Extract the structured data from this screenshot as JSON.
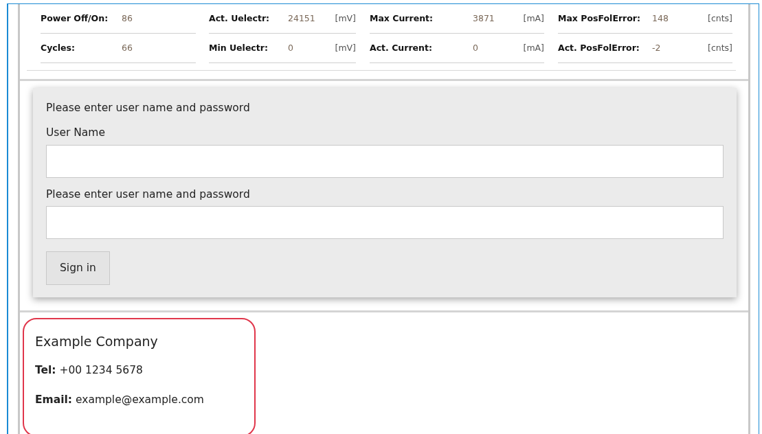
{
  "stats": {
    "columns": [
      {
        "rows": [
          {
            "label": "Power Off/On:",
            "value": "86"
          },
          {
            "label": "Cycles:",
            "value": "66"
          }
        ]
      },
      {
        "rows": [
          {
            "label": "Act. Uelectr:",
            "value": "24151",
            "unit": "[mV]"
          },
          {
            "label": "Min Uelectr:",
            "value": "0",
            "unit": "[mV]"
          }
        ]
      },
      {
        "rows": [
          {
            "label": "Max Current:",
            "value": "3871",
            "unit": "[mA]"
          },
          {
            "label": "Act. Current:",
            "value": "0",
            "unit": "[mA]"
          }
        ]
      },
      {
        "rows": [
          {
            "label": "Max PosFolError:",
            "value": "148",
            "unit": "[cnts]"
          },
          {
            "label": "Act. PosFolError:",
            "value": "-2",
            "unit": "[cnts]"
          }
        ]
      }
    ]
  },
  "login": {
    "prompt": "Please enter user name and password",
    "fields": [
      {
        "label": "User Name"
      },
      {
        "label": "Please enter user name and password"
      }
    ],
    "button": "Sign in"
  },
  "contact": {
    "company": "Example Company",
    "lines": [
      {
        "label": "Tel:",
        "value": "+00 1234 5678"
      },
      {
        "label": "Email:",
        "value": "example@example.com"
      }
    ]
  }
}
